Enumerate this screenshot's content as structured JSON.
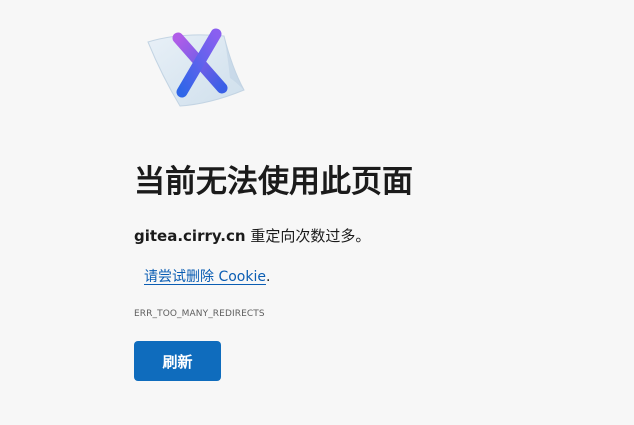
{
  "illustration": {
    "icon": "error-document-x-icon",
    "colors": {
      "paper": "#dbe8f3",
      "x_gradient_start": "#b05de8",
      "x_gradient_end": "#2f66e8"
    }
  },
  "error": {
    "title": "当前无法使用此页面",
    "host": "gitea.cirry.cn",
    "message_suffix": " 重定向次数过多。",
    "suggestion_link": "请尝试删除 Cookie",
    "suggestion_punct": ".",
    "code": "ERR_TOO_MANY_REDIRECTS"
  },
  "actions": {
    "refresh_label": "刷新"
  },
  "colors": {
    "background": "#f7f7f7",
    "accent": "#0f6cbd",
    "link": "#0a5db3"
  }
}
